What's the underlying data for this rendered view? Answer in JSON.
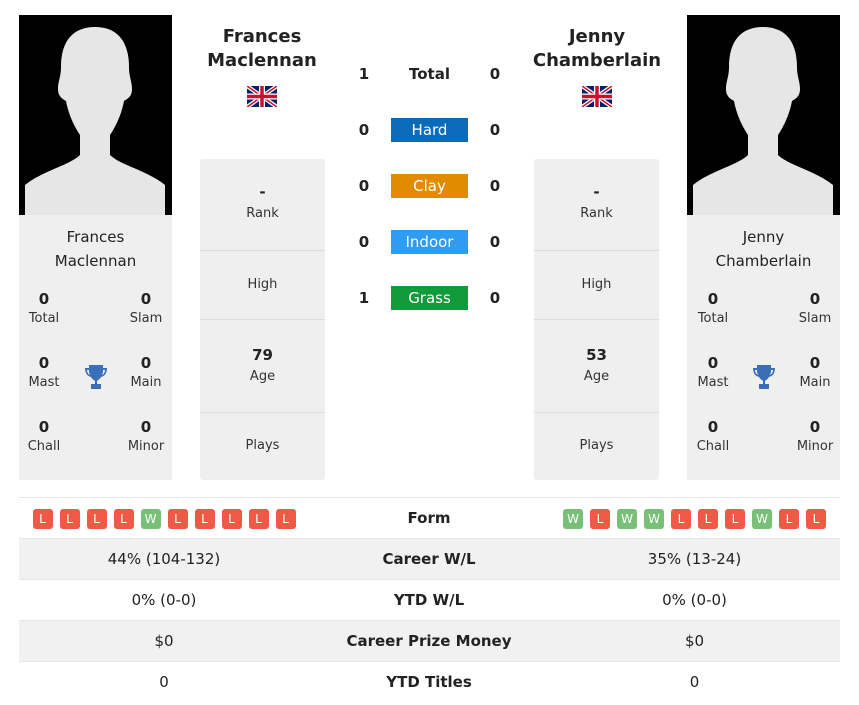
{
  "colors": {
    "hard": "#0c6bb8",
    "clay": "#e08b00",
    "indoor": "#2e9cf0",
    "grass": "#129a3b",
    "win": "#78c078",
    "loss": "#ee5a45",
    "trophy": "#3a6fb8"
  },
  "player1": {
    "name": "Frances Maclennan",
    "name_line1": "Frances",
    "name_line2": "Maclennan",
    "flag": "uk-flag-icon",
    "titles": {
      "total": "0",
      "slam": "0",
      "mast": "0",
      "main": "0",
      "chall": "0",
      "minor": "0"
    },
    "rank": "-",
    "high": "",
    "age": "79",
    "plays": "",
    "form": [
      "L",
      "L",
      "L",
      "L",
      "W",
      "L",
      "L",
      "L",
      "L",
      "L"
    ],
    "career_wl": "44% (104-132)",
    "ytd_wl": "0% (0-0)",
    "prize": "$0",
    "ytd_titles": "0"
  },
  "player2": {
    "name": "Jenny Chamberlain",
    "name_line1": "Jenny",
    "name_line2": "Chamberlain",
    "flag": "uk-flag-icon",
    "titles": {
      "total": "0",
      "slam": "0",
      "mast": "0",
      "main": "0",
      "chall": "0",
      "minor": "0"
    },
    "rank": "-",
    "high": "",
    "age": "53",
    "plays": "",
    "form": [
      "W",
      "L",
      "W",
      "W",
      "L",
      "L",
      "L",
      "W",
      "L",
      "L"
    ],
    "career_wl": "35% (13-24)",
    "ytd_wl": "0% (0-0)",
    "prize": "$0",
    "ytd_titles": "0"
  },
  "labels": {
    "total": "Total",
    "slam": "Slam",
    "mast": "Mast",
    "main": "Main",
    "chall": "Chall",
    "minor": "Minor",
    "rank": "Rank",
    "high": "High",
    "age": "Age",
    "plays": "Plays",
    "form": "Form",
    "career_wl": "Career W/L",
    "ytd_wl": "YTD W/L",
    "prize": "Career Prize Money",
    "ytd_titles": "YTD Titles"
  },
  "h2h": [
    {
      "label": "Total",
      "p1": "1",
      "p2": "0"
    },
    {
      "label": "Hard",
      "p1": "0",
      "p2": "0"
    },
    {
      "label": "Clay",
      "p1": "0",
      "p2": "0"
    },
    {
      "label": "Indoor",
      "p1": "0",
      "p2": "0"
    },
    {
      "label": "Grass",
      "p1": "1",
      "p2": "0"
    }
  ]
}
